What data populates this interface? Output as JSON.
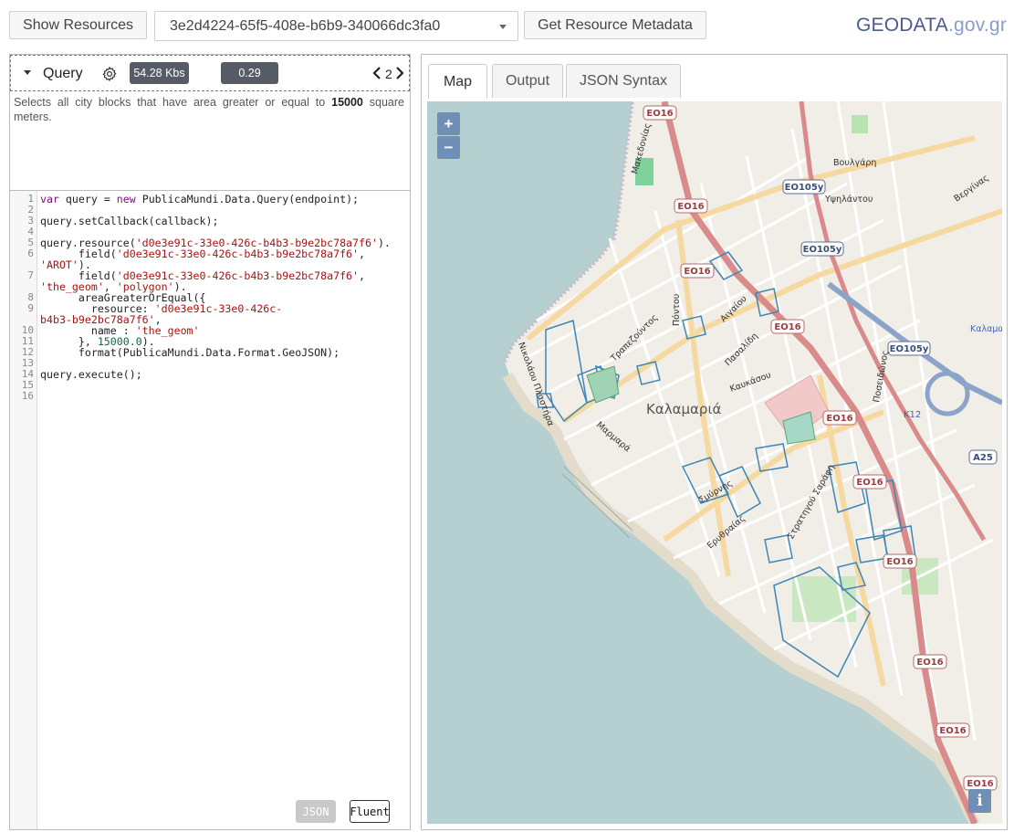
{
  "toolbar": {
    "show_resources_label": "Show Resources",
    "resource_selected": "3e2d4224-65f5-408e-b6b9-340066dc3fa0",
    "get_metadata_label": "Get Resource Metadata"
  },
  "logo": {
    "brand": "GEODATA",
    "suffix": ".gov.gr"
  },
  "query": {
    "title": "Query",
    "size": "54.28 Kbs",
    "time": "0.29 secs",
    "page": "2",
    "description_before": "Selects all city blocks that have area greater or equal to ",
    "description_value": "15000",
    "description_after": " square meters."
  },
  "editor": {
    "line_numbers": [
      "1",
      "2",
      "3",
      "4",
      "5",
      "6",
      "",
      "7",
      "",
      "8",
      "9",
      "",
      "10",
      "11",
      "12",
      "13",
      "14",
      "15",
      "16"
    ],
    "json_button": "JSON",
    "fluent_button": "Fluent"
  },
  "tabs": {
    "map": "Map",
    "output": "Output",
    "json": "JSON Syntax"
  },
  "map": {
    "zoom_in": "+",
    "zoom_out": "−",
    "info": "i",
    "district_label": "Καλαμαριά",
    "road_shields": [
      "EO16",
      "EO105y",
      "A25",
      "K12"
    ],
    "street_labels": [
      "Μακεδονίας",
      "Βουλγάρη",
      "Υψηλάντου",
      "Πόντου",
      "Αιγαίου",
      "Πασαλίδη",
      "Καυκάσου",
      "Ποσειδώνος",
      "Νικολάου Πλαστήρα",
      "Σμύρνης",
      "Ερυθραίας",
      "Μαρμαρά",
      "Τραπεζούντος",
      "Στρατηγού Σαράφη",
      "Βεργίνας",
      "Καλαμαριά"
    ]
  }
}
